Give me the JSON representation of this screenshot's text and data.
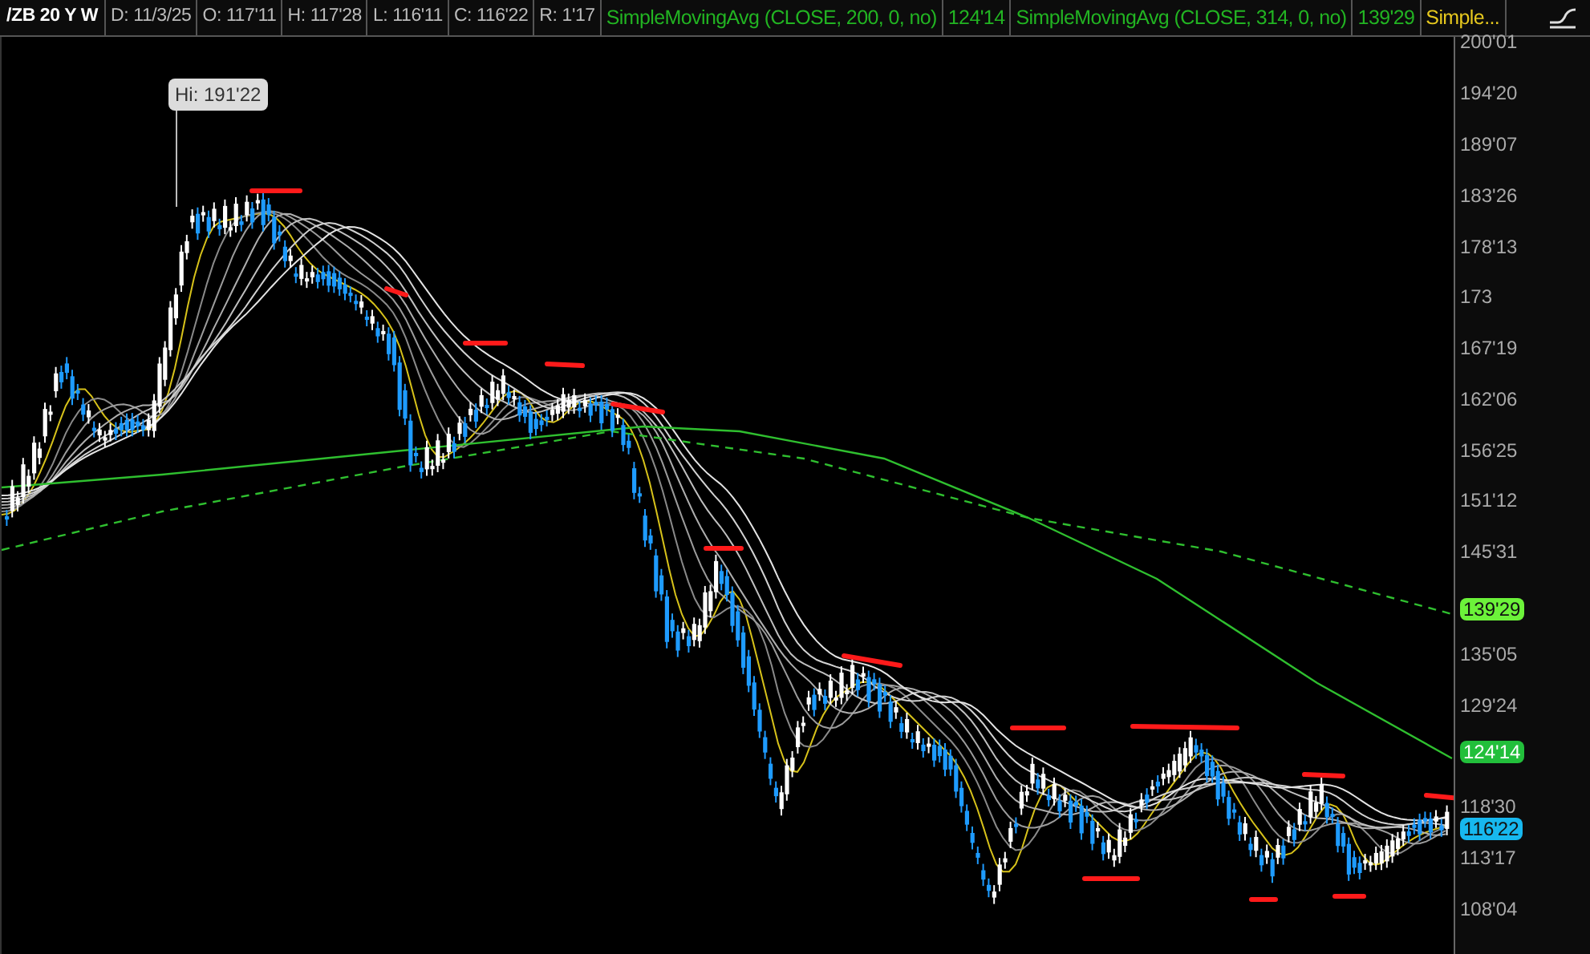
{
  "header": {
    "symbol": "/ZB 20 Y W",
    "fields": [
      "D: 11/3/25",
      "O: 117'11",
      "H: 117'28",
      "L: 116'11",
      "C: 116'22",
      "R: 1'17"
    ],
    "studies": [
      {
        "label": "SimpleMovingAvg (CLOSE, 200, 0, no)",
        "kind": "sma"
      },
      {
        "label": "124'14",
        "kind": "sma"
      },
      {
        "label": "SimpleMovingAvg (CLOSE, 314, 0, no)",
        "kind": "sma"
      },
      {
        "label": "139'29",
        "kind": "sma"
      },
      {
        "label": "Simple...",
        "kind": "ribbon"
      }
    ]
  },
  "chart": {
    "high_label": "Hi: 191'22"
  },
  "price_axis": {
    "ticks": [
      "200'01",
      "194'20",
      "189'07",
      "183'26",
      "178'13",
      "173",
      "167'19",
      "162'06",
      "156'25",
      "151'12",
      "145'31",
      "135'05",
      "129'24",
      "118'30",
      "113'17",
      "108'04"
    ],
    "markers": [
      {
        "label": "139'29",
        "color": "#6cf23a"
      },
      {
        "label": "124'14",
        "color": "#22bf3b"
      },
      {
        "label": "116'22",
        "color": "#17b8ef"
      }
    ]
  }
}
